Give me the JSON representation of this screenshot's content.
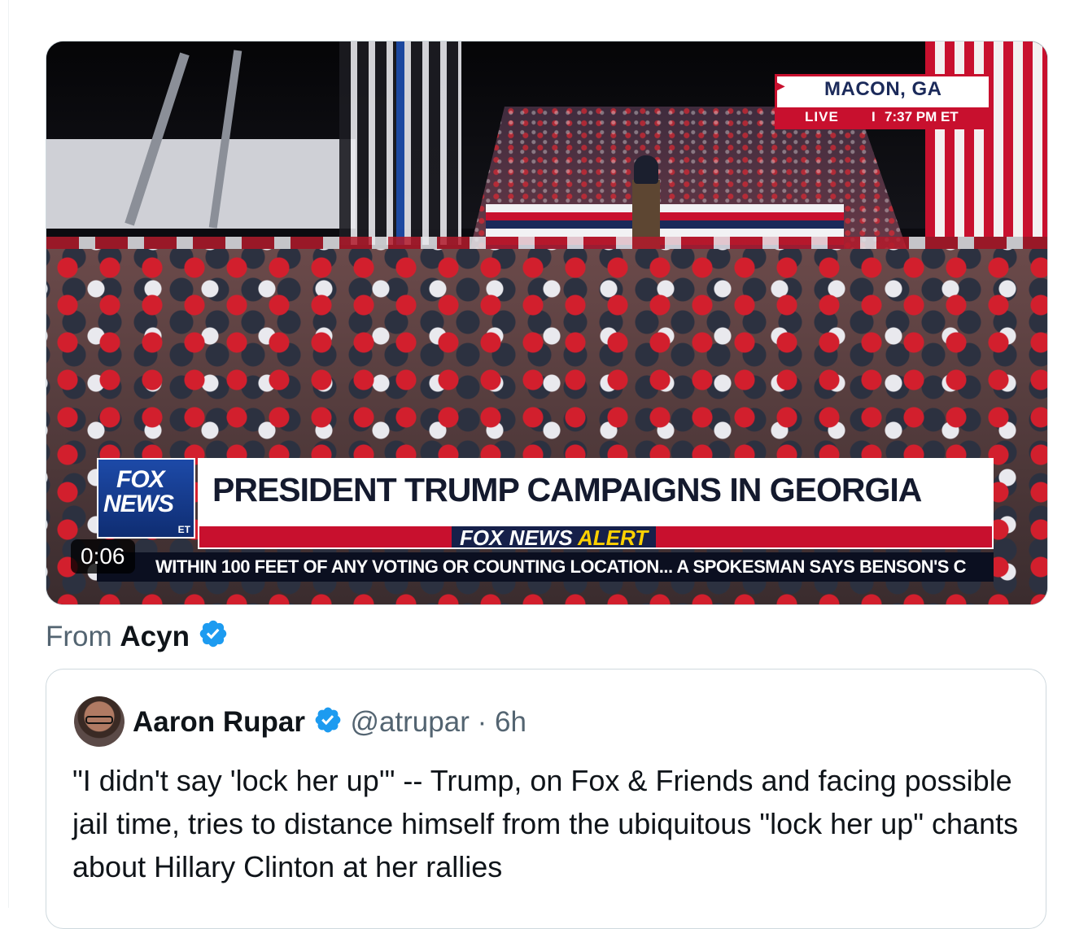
{
  "video": {
    "location": "MACON, GA",
    "live_label": "LIVE",
    "separator": "I",
    "time": "7:37 PM ET",
    "network_logo_line1": "FOX",
    "network_logo_line2": "NEWS",
    "network_logo_sub": "ET",
    "headline": "PRESIDENT TRUMP CAMPAIGNS IN GEORGIA",
    "alert_brand": "FOX NEWS",
    "alert_word": "ALERT",
    "ticker": "WITHIN 100 FEET OF ANY VOTING OR COUNTING LOCATION...   A SPOKESMAN SAYS BENSON'S C",
    "timestamp": "0:06"
  },
  "attribution": {
    "prefix": "From",
    "name": "Acyn"
  },
  "quoted_tweet": {
    "name": "Aaron Rupar",
    "handle": "@atrupar",
    "dot": "·",
    "time": "6h",
    "text": "\"I didn't say 'lock her up'\" -- Trump, on Fox & Friends and facing possible jail time, tries to distance himself from the ubiquitous \"lock her up\" chants about Hillary Clinton at her rallies"
  },
  "colors": {
    "verified": "#1d9bf0",
    "fox_red": "#c8102e",
    "fox_blue": "#1d4aa8",
    "muted_text": "#536471"
  },
  "icons": [
    "verified-badge-icon",
    "play-arrow-icon"
  ]
}
